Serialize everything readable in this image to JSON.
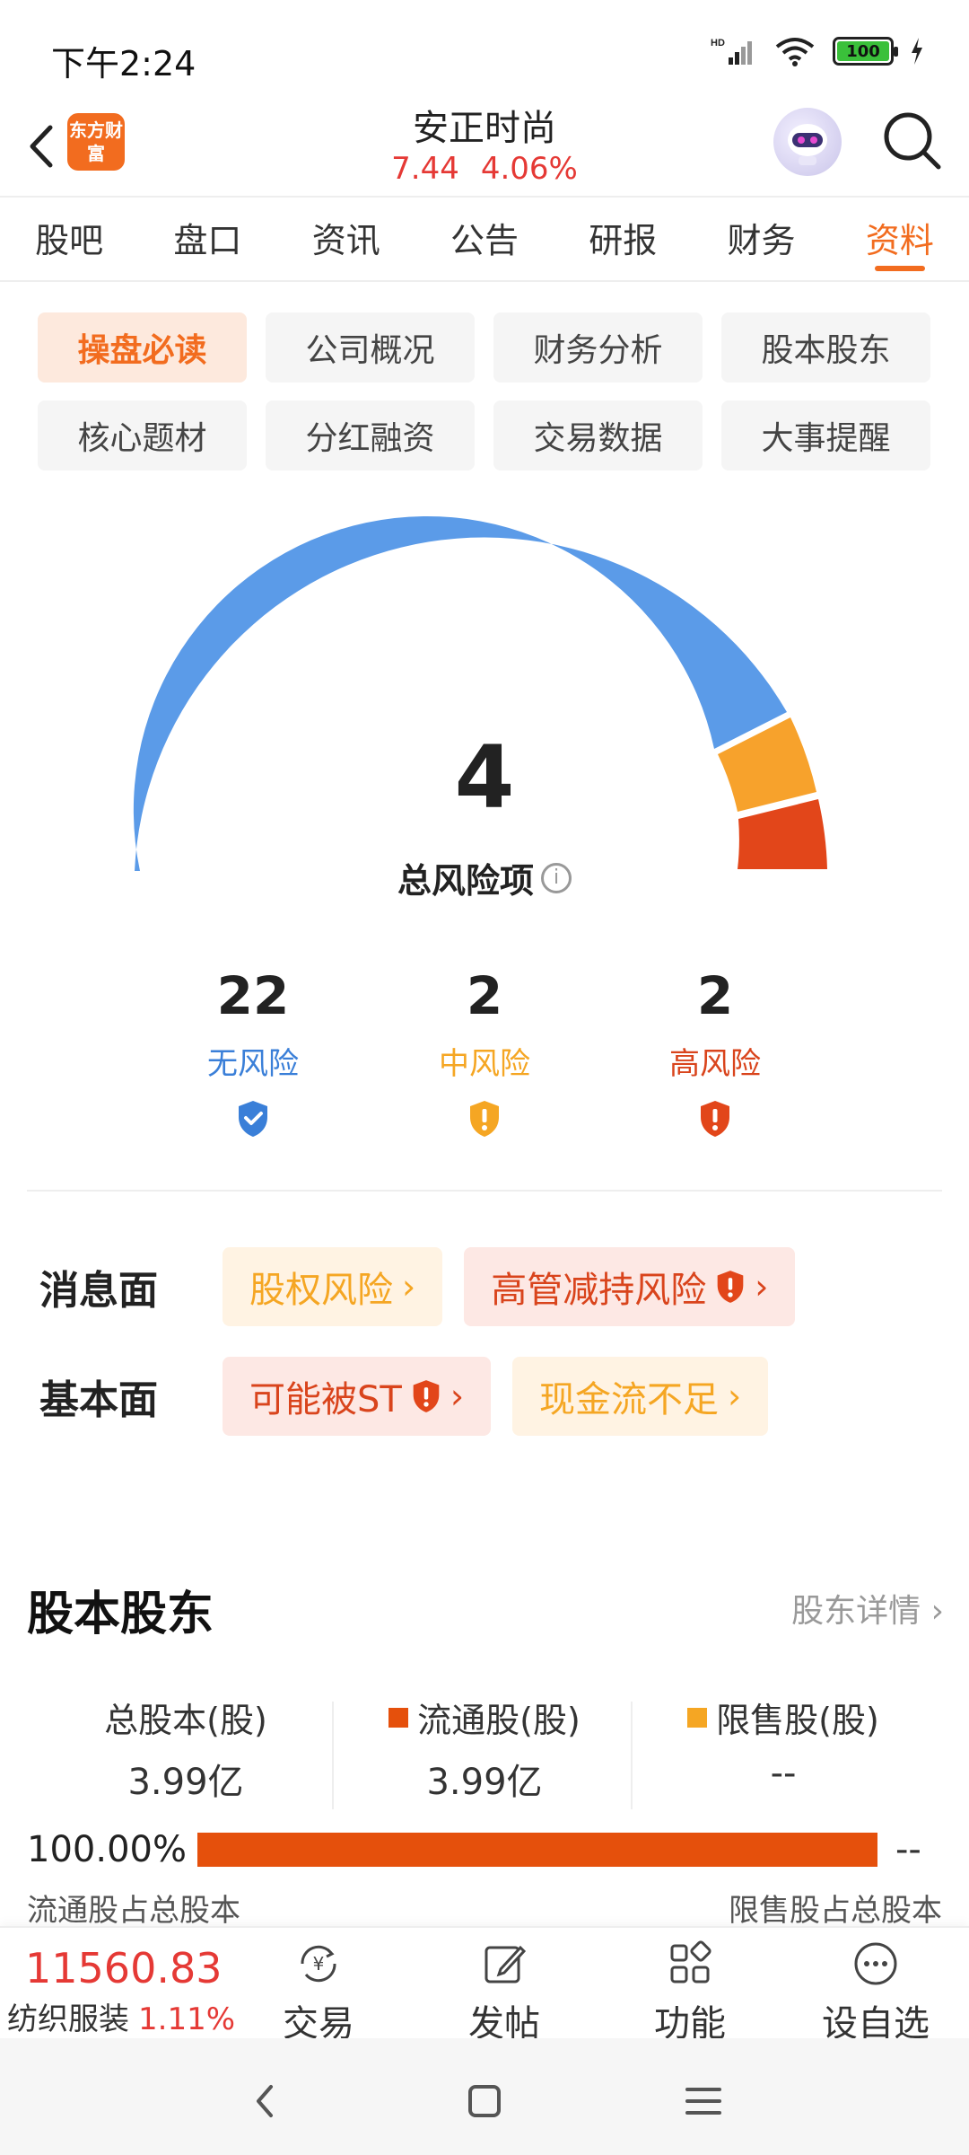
{
  "status_bar": {
    "time": "下午2:24",
    "battery": "100"
  },
  "header": {
    "logo_text": "东方财富",
    "stock_name": "安正时尚",
    "price": "7.44",
    "change_pct": "4.06%"
  },
  "tabs": [
    {
      "label": "股吧",
      "active": false
    },
    {
      "label": "盘口",
      "active": false
    },
    {
      "label": "资讯",
      "active": false
    },
    {
      "label": "公告",
      "active": false
    },
    {
      "label": "研报",
      "active": false
    },
    {
      "label": "财务",
      "active": false
    },
    {
      "label": "资料",
      "active": true
    }
  ],
  "sub_nav": [
    {
      "label": "操盘必读",
      "active": true
    },
    {
      "label": "公司概况",
      "active": false
    },
    {
      "label": "财务分析",
      "active": false
    },
    {
      "label": "股本股东",
      "active": false
    },
    {
      "label": "核心题材",
      "active": false
    },
    {
      "label": "分红融资",
      "active": false
    },
    {
      "label": "交易数据",
      "active": false
    },
    {
      "label": "大事提醒",
      "active": false
    }
  ],
  "risk_summary": {
    "total": "4",
    "total_label": "总风险项",
    "no_risk": {
      "count": "22",
      "label": "无风险",
      "color": "#3a7fd8"
    },
    "mid_risk": {
      "count": "2",
      "label": "中风险",
      "color": "#f5a623"
    },
    "high_risk": {
      "count": "2",
      "label": "高风险",
      "color": "#d9441c"
    },
    "gauge_colors": {
      "blue": "#5b9be8",
      "orange": "#f7a22c",
      "red": "#e2461a"
    }
  },
  "factors": {
    "news": {
      "title": "消息面",
      "tags": [
        {
          "label": "股权风险",
          "level": "mid"
        },
        {
          "label": "高管减持风险",
          "level": "high"
        }
      ]
    },
    "basic": {
      "title": "基本面",
      "tags": [
        {
          "label": "可能被ST",
          "level": "high"
        },
        {
          "label": "现金流不足",
          "level": "mid"
        }
      ]
    }
  },
  "equity": {
    "title": "股本股东",
    "link": "股东详情",
    "total_label": "总股本(股)",
    "total_value": "3.99亿",
    "float_label": "流通股(股)",
    "float_value": "3.99亿",
    "restricted_label": "限售股(股)",
    "restricted_value": "--",
    "float_pct": "100.00%",
    "float_fraction": 1.0,
    "restricted_pct": "--",
    "float_caption": "流通股占总股本",
    "restricted_caption": "限售股占总股本",
    "float_color": "#e5500c",
    "restricted_color": "#f5a623"
  },
  "bottom_bar": {
    "index_value": "11560.83",
    "index_name": "纺织服装",
    "index_change": "1.11%",
    "trade": "交易",
    "post": "发帖",
    "functions": "功能",
    "add_watch": "设自选"
  }
}
